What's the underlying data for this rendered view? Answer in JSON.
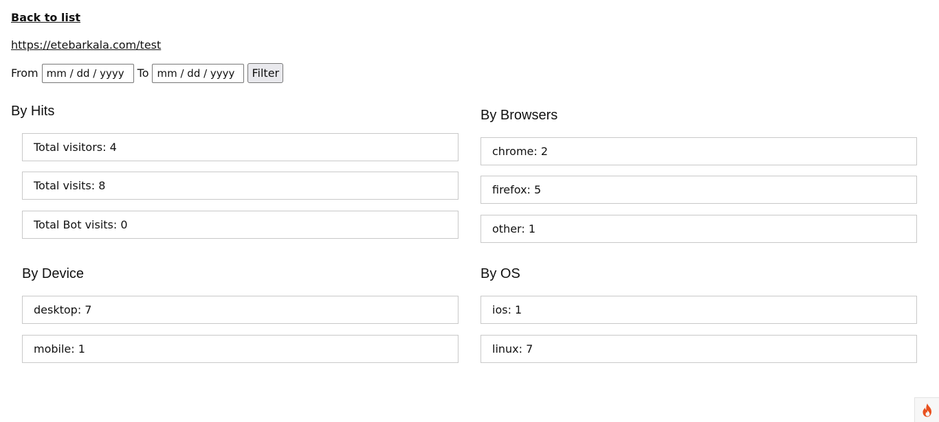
{
  "nav": {
    "back_label": "Back to list",
    "url_text": "https://etebarkala.com/test"
  },
  "filter": {
    "from_label": "From",
    "from_value": "mm / dd / yyyy",
    "to_label": "To",
    "to_value": "mm / dd / yyyy",
    "button_label": "Filter"
  },
  "hits": {
    "title": "By Hits",
    "items": [
      {
        "label": "Total visitors: 4"
      },
      {
        "label": "Total visits: 8"
      },
      {
        "label": "Total Bot visits: 0"
      }
    ]
  },
  "browsers": {
    "title": "By Browsers",
    "items": [
      {
        "label": "chrome: 2"
      },
      {
        "label": "firefox: 5"
      },
      {
        "label": "other: 1"
      }
    ]
  },
  "device": {
    "title": "By Device",
    "items": [
      {
        "label": "desktop: 7"
      },
      {
        "label": "mobile: 1"
      }
    ]
  },
  "os": {
    "title": "By OS",
    "items": [
      {
        "label": "ios: 1"
      },
      {
        "label": "linux: 7"
      }
    ]
  },
  "colors": {
    "flame_outer": "#e8501e",
    "flame_inner": "#f7f7f7"
  },
  "icons": {
    "corner": "flame-icon"
  }
}
